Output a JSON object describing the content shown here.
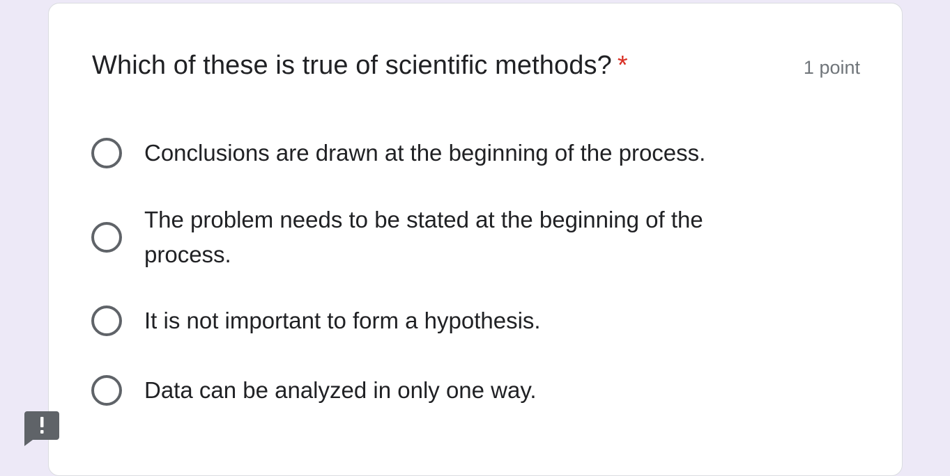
{
  "question": {
    "title": "Which of these is true of scientific methods?",
    "required_marker": "*",
    "points": "1 point"
  },
  "options": [
    {
      "label": "Conclusions are drawn at the beginning of the process."
    },
    {
      "label": "The problem needs to be stated at the beginning of the process."
    },
    {
      "label": "It is not important to form a hypothesis."
    },
    {
      "label": "Data can be analyzed in only one way."
    }
  ],
  "icons": {
    "report": "report-problem-icon"
  },
  "colors": {
    "background": "#ede9f7",
    "card": "#ffffff",
    "required": "#d93025",
    "radio_border": "#5f6368",
    "report_icon": "#5f6368"
  }
}
